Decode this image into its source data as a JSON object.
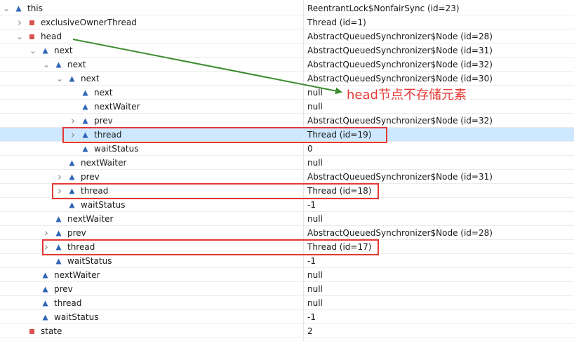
{
  "colors": {
    "field_icon": "#2f64b5",
    "private_icon": "#d9534f",
    "selection": "#cde8ff",
    "highlight_box": "#e53935",
    "arrow": "#3c8d2f",
    "annotation": "#e53935"
  },
  "variables": [
    {
      "name": "this",
      "value": "ReentrantLock$NonfairSync  (id=23)",
      "depth": 0,
      "icon": "field-triangle-icon",
      "toggle": "expanded"
    },
    {
      "name": "exclusiveOwnerThread",
      "value": "Thread  (id=1)",
      "depth": 1,
      "icon": "private-square-icon",
      "toggle": "collapsed"
    },
    {
      "name": "head",
      "value": "AbstractQueuedSynchronizer$Node  (id=28)",
      "depth": 1,
      "icon": "private-square-icon",
      "toggle": "expanded"
    },
    {
      "name": "next",
      "value": "AbstractQueuedSynchronizer$Node  (id=31)",
      "depth": 2,
      "icon": "field-triangle-icon",
      "toggle": "expanded"
    },
    {
      "name": "next",
      "value": "AbstractQueuedSynchronizer$Node  (id=32)",
      "depth": 3,
      "icon": "field-triangle-icon",
      "toggle": "expanded"
    },
    {
      "name": "next",
      "value": "AbstractQueuedSynchronizer$Node  (id=30)",
      "depth": 4,
      "icon": "field-triangle-icon",
      "toggle": "expanded"
    },
    {
      "name": "next",
      "value": "null",
      "depth": 5,
      "icon": "field-triangle-icon",
      "toggle": "none"
    },
    {
      "name": "nextWaiter",
      "value": "null",
      "depth": 5,
      "icon": "field-triangle-icon",
      "toggle": "none"
    },
    {
      "name": "prev",
      "value": "AbstractQueuedSynchronizer$Node  (id=32)",
      "depth": 5,
      "icon": "field-triangle-icon",
      "toggle": "collapsed"
    },
    {
      "name": "thread",
      "value": "Thread  (id=19)",
      "depth": 5,
      "icon": "field-triangle-icon",
      "toggle": "collapsed",
      "selected": true
    },
    {
      "name": "waitStatus",
      "value": "0",
      "depth": 5,
      "icon": "field-triangle-icon",
      "toggle": "none"
    },
    {
      "name": "nextWaiter",
      "value": "null",
      "depth": 4,
      "icon": "field-triangle-icon",
      "toggle": "none"
    },
    {
      "name": "prev",
      "value": "AbstractQueuedSynchronizer$Node  (id=31)",
      "depth": 4,
      "icon": "field-triangle-icon",
      "toggle": "collapsed"
    },
    {
      "name": "thread",
      "value": "Thread  (id=18)",
      "depth": 4,
      "icon": "field-triangle-icon",
      "toggle": "collapsed"
    },
    {
      "name": "waitStatus",
      "value": "-1",
      "depth": 4,
      "icon": "field-triangle-icon",
      "toggle": "none"
    },
    {
      "name": "nextWaiter",
      "value": "null",
      "depth": 3,
      "icon": "field-triangle-icon",
      "toggle": "none"
    },
    {
      "name": "prev",
      "value": "AbstractQueuedSynchronizer$Node  (id=28)",
      "depth": 3,
      "icon": "field-triangle-icon",
      "toggle": "collapsed"
    },
    {
      "name": "thread",
      "value": "Thread  (id=17)",
      "depth": 3,
      "icon": "field-triangle-icon",
      "toggle": "collapsed"
    },
    {
      "name": "waitStatus",
      "value": "-1",
      "depth": 3,
      "icon": "field-triangle-icon",
      "toggle": "none"
    },
    {
      "name": "nextWaiter",
      "value": "null",
      "depth": 2,
      "icon": "field-triangle-icon",
      "toggle": "none"
    },
    {
      "name": "prev",
      "value": "null",
      "depth": 2,
      "icon": "field-triangle-icon",
      "toggle": "none"
    },
    {
      "name": "thread",
      "value": "null",
      "depth": 2,
      "icon": "field-triangle-icon",
      "toggle": "none"
    },
    {
      "name": "waitStatus",
      "value": "-1",
      "depth": 2,
      "icon": "field-triangle-icon",
      "toggle": "none"
    },
    {
      "name": "state",
      "value": "2",
      "depth": 1,
      "icon": "private-square-icon",
      "toggle": "none"
    }
  ],
  "annotation": {
    "text": "head节点不存储元素"
  }
}
